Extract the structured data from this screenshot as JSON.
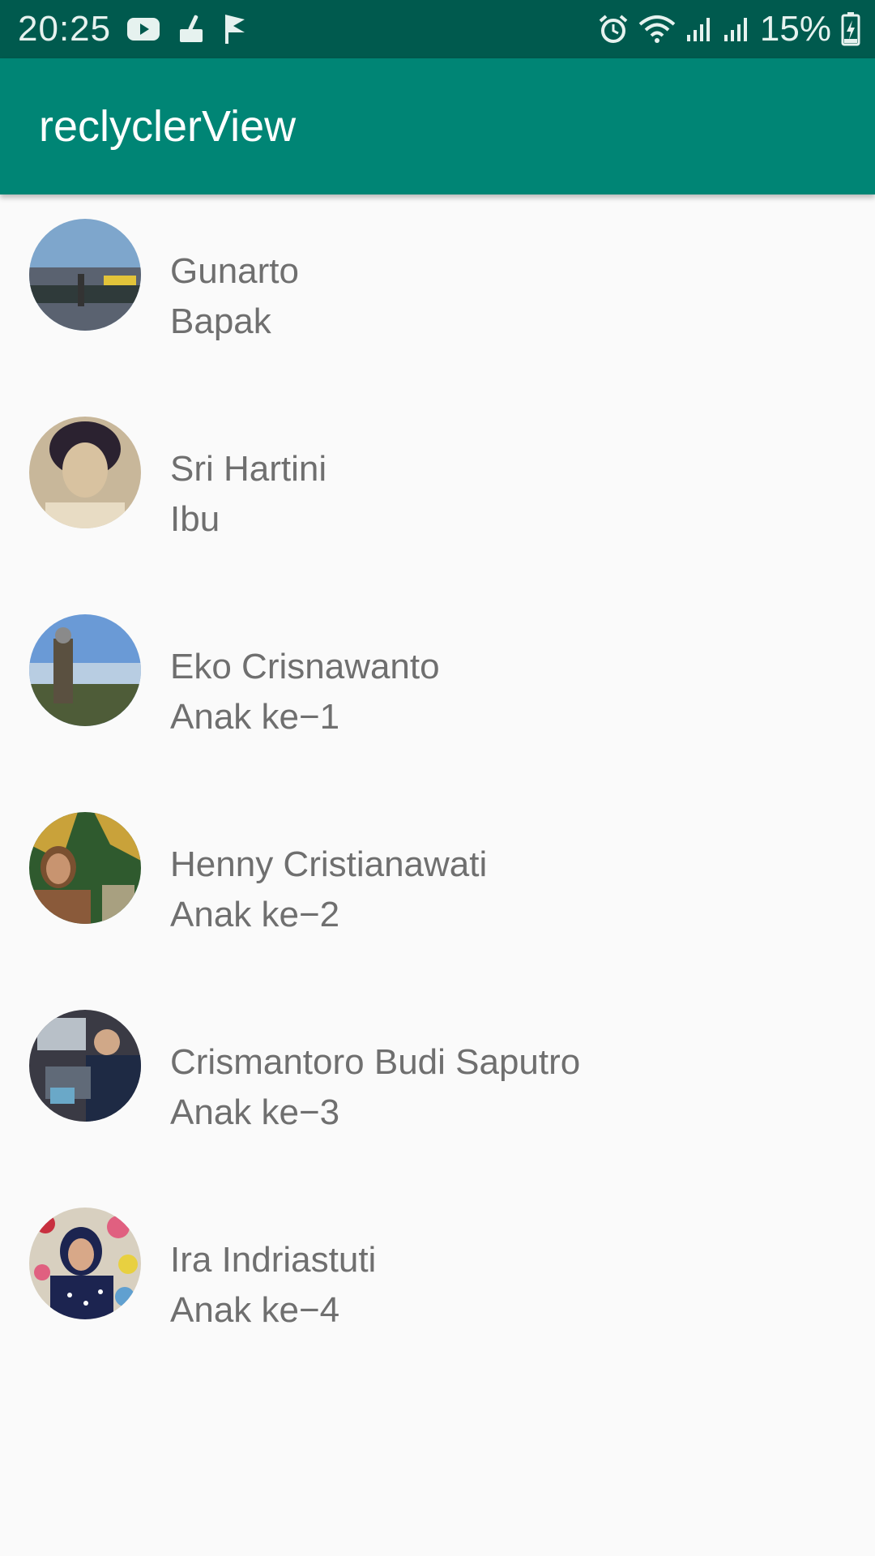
{
  "status_bar": {
    "time": "20:25",
    "battery_percent": "15%",
    "left_icons": [
      "youtube-icon",
      "cleaner-icon",
      "flag-icon"
    ],
    "right_icons": [
      "alarm-icon",
      "wifi-icon",
      "signal-icon",
      "signal-icon",
      "battery-charging-icon"
    ]
  },
  "app_bar": {
    "title": "reclyclerView"
  },
  "colors": {
    "status_bar": "#005a4e",
    "app_bar": "#008575",
    "background": "#fafafa",
    "list_text": "#6f6f6f"
  },
  "items": [
    {
      "name": "Gunarto",
      "role": "Bapak"
    },
    {
      "name": "Sri Hartini",
      "role": "Ibu"
    },
    {
      "name": "Eko Crisnawanto",
      "role": "Anak ke−1"
    },
    {
      "name": "Henny Cristianawati",
      "role": "Anak ke−2"
    },
    {
      "name": "Crismantoro Budi Saputro",
      "role": "Anak ke−3"
    },
    {
      "name": "Ira Indriastuti",
      "role": "Anak ke−4"
    }
  ]
}
